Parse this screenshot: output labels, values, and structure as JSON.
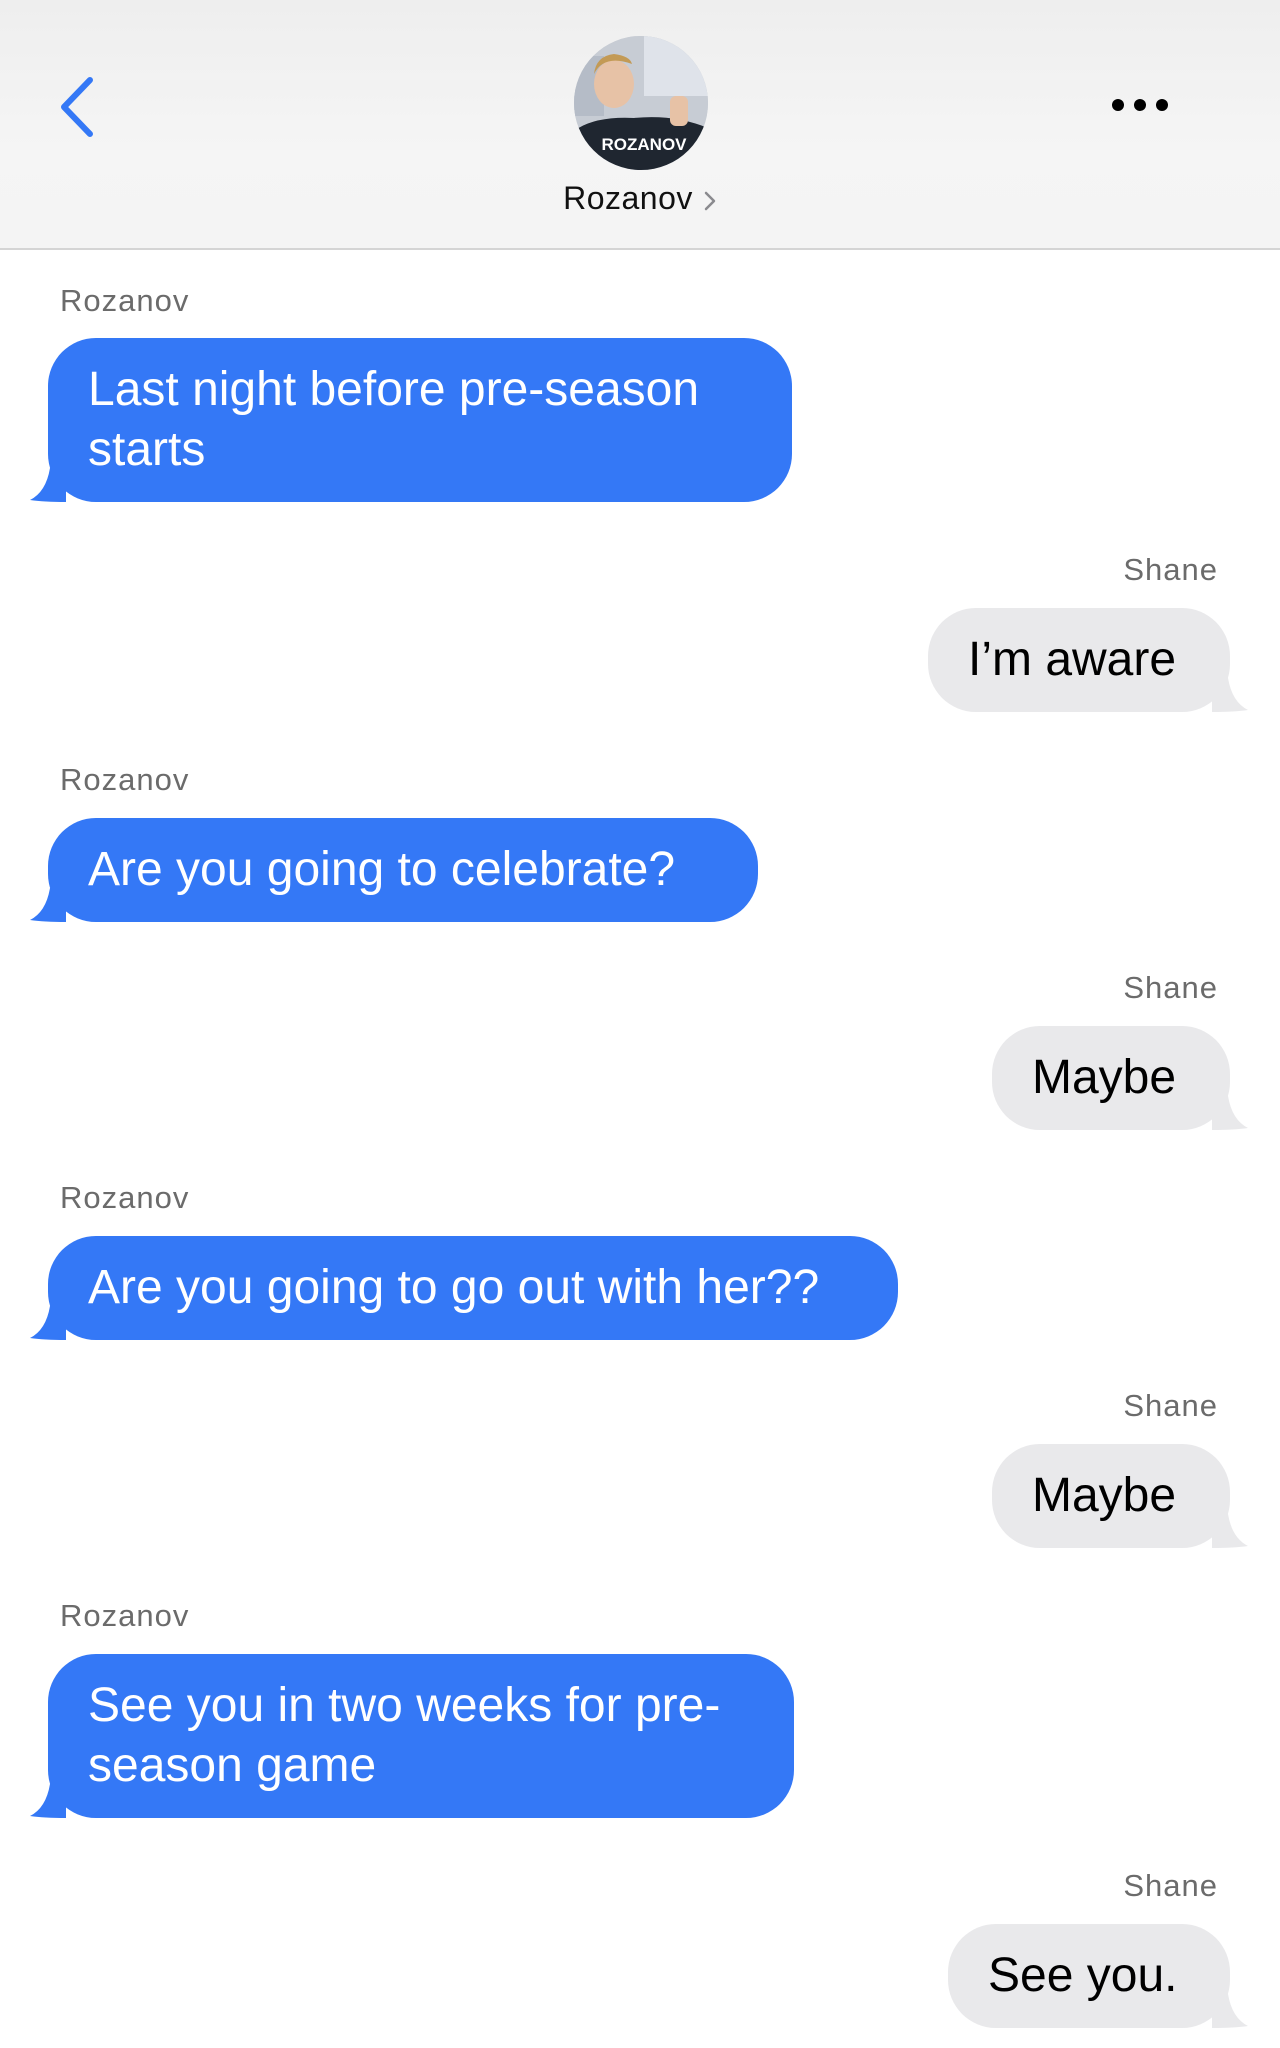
{
  "header": {
    "contact_name": "Rozanov",
    "avatar_jersey_text": "ROZANOV",
    "back_icon": "chevron-left-icon",
    "more_icon": "ellipsis-icon"
  },
  "colors": {
    "accent": "#3478f6",
    "incoming_bubble": "#3478f6",
    "outgoing_bubble": "#e9e9eb"
  },
  "messages": [
    {
      "sender": "Rozanov",
      "text_lines": [
        "Last night before pre-season",
        "starts"
      ]
    },
    {
      "sender": "Shane",
      "text_lines": [
        "I’m aware"
      ]
    },
    {
      "sender": "Rozanov",
      "text_lines": [
        "Are you going to celebrate?"
      ]
    },
    {
      "sender": "Shane",
      "text_lines": [
        "Maybe"
      ]
    },
    {
      "sender": "Rozanov",
      "text_lines": [
        "Are you going to go out with her??"
      ]
    },
    {
      "sender": "Shane",
      "text_lines": [
        "Maybe"
      ]
    },
    {
      "sender": "Rozanov",
      "text_lines": [
        "See you in two weeks for pre-",
        "season game"
      ]
    },
    {
      "sender": "Shane",
      "text_lines": [
        "See you."
      ]
    }
  ]
}
